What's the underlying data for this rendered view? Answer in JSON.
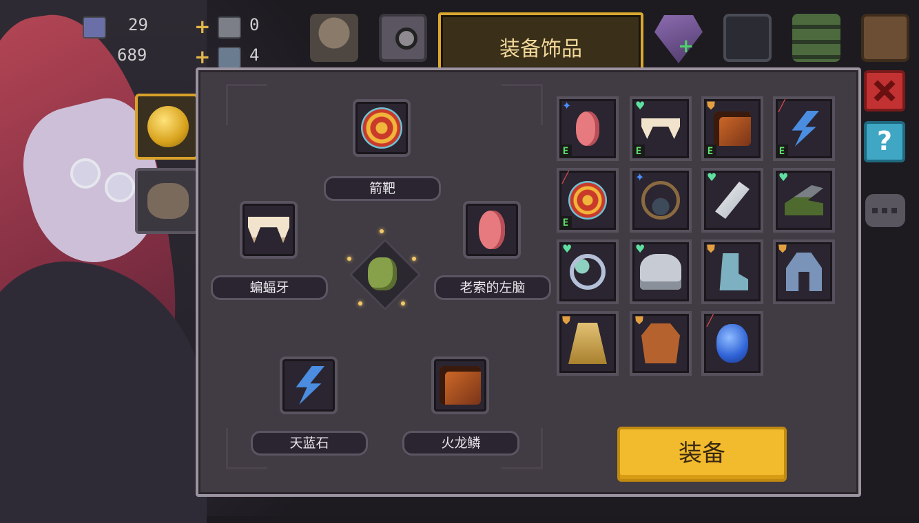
{
  "top_bar": {
    "resource1_value": "29",
    "resource2_value": "689",
    "counter1_value": "0",
    "counter2_value": "4",
    "tab_title": "装备饰品"
  },
  "equipped": {
    "top": {
      "label": "箭靶",
      "icon": "target-icon"
    },
    "left": {
      "label": "蝙蝠牙",
      "icon": "bat-fang-icon"
    },
    "right": {
      "label": "老索的左脑",
      "icon": "left-brain-icon"
    },
    "bottom_left": {
      "label": "天蓝石",
      "icon": "sky-stone-icon"
    },
    "bottom_right": {
      "label": "火龙鳞",
      "icon": "fire-dragon-scale-icon"
    },
    "center": {
      "icon": "fish-character-icon"
    }
  },
  "inventory": [
    {
      "icon": "left-brain-icon",
      "tier_icon": "star",
      "equipped_badge": "E"
    },
    {
      "icon": "bat-fang-icon",
      "tier_icon": "heart",
      "equipped_badge": "E"
    },
    {
      "icon": "fire-dragon-scale-icon",
      "tier_icon": "shield",
      "equipped_badge": "E"
    },
    {
      "icon": "sky-stone-icon",
      "tier_icon": "sword",
      "equipped_badge": "E"
    },
    {
      "icon": "target-icon",
      "tier_icon": "sword",
      "equipped_badge": "E"
    },
    {
      "icon": "necklace-icon",
      "tier_icon": "star",
      "equipped_badge": ""
    },
    {
      "icon": "feather-icon",
      "tier_icon": "heart",
      "equipped_badge": ""
    },
    {
      "icon": "cannon-icon",
      "tier_icon": "heart",
      "equipped_badge": ""
    },
    {
      "icon": "ring-icon",
      "tier_icon": "heart",
      "equipped_badge": ""
    },
    {
      "icon": "helmet-icon",
      "tier_icon": "heart",
      "equipped_badge": ""
    },
    {
      "icon": "boot-icon",
      "tier_icon": "shield",
      "equipped_badge": ""
    },
    {
      "icon": "armor-icon",
      "tier_icon": "shield",
      "equipped_badge": ""
    },
    {
      "icon": "cape-icon",
      "tier_icon": "shield",
      "equipped_badge": ""
    },
    {
      "icon": "vest-icon",
      "tier_icon": "shield",
      "equipped_badge": ""
    },
    {
      "icon": "blue-gem-icon",
      "tier_icon": "sword",
      "equipped_badge": ""
    }
  ],
  "equip_button_label": "装备",
  "colors": {
    "accent_gold": "#f2bb2e",
    "panel": "#413c43",
    "slot": "#2a2530",
    "equipped_badge": "#5fe06a"
  }
}
